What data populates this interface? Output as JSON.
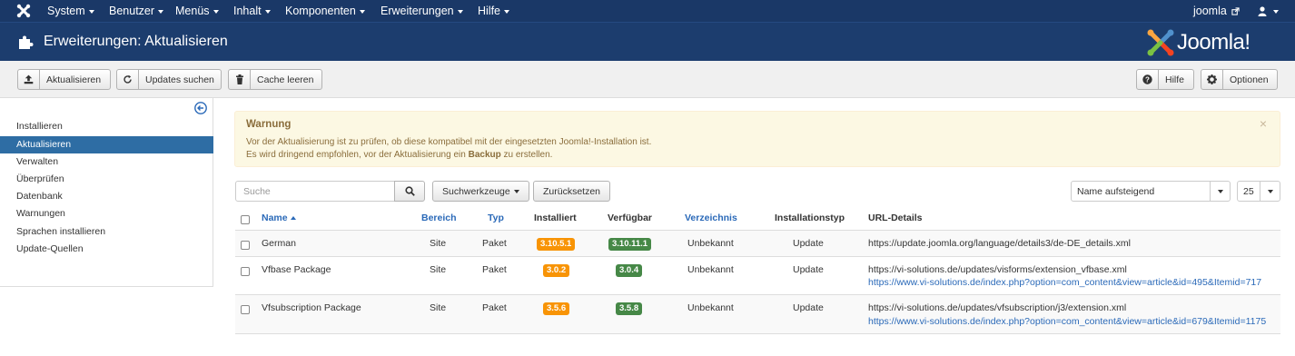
{
  "navbar": {
    "menu": [
      "System",
      "Benutzer",
      "Menüs",
      "Inhalt",
      "Komponenten",
      "Erweiterungen",
      "Hilfe"
    ],
    "site_link": "joomla",
    "user_icon": "user-icon"
  },
  "header": {
    "title": "Erweiterungen: Aktualisieren",
    "brand": "Joomla!"
  },
  "toolbar": {
    "update_label": "Aktualisieren",
    "find_label": "Updates suchen",
    "purge_label": "Cache leeren",
    "help_label": "Hilfe",
    "options_label": "Optionen"
  },
  "sidebar": {
    "items": [
      {
        "label": "Installieren"
      },
      {
        "label": "Aktualisieren"
      },
      {
        "label": "Verwalten"
      },
      {
        "label": "Überprüfen"
      },
      {
        "label": "Datenbank"
      },
      {
        "label": "Warnungen"
      },
      {
        "label": "Sprachen installieren"
      },
      {
        "label": "Update-Quellen"
      }
    ],
    "active_index": 1
  },
  "alert": {
    "heading": "Warnung",
    "line1": "Vor der Aktualisierung ist zu prüfen, ob diese kompatibel mit der eingesetzten Joomla!-Installation ist.",
    "line2_pre": "Es wird dringend empfohlen, vor der Aktualisierung ein ",
    "line2_bold": "Backup",
    "line2_post": " zu erstellen.",
    "close": "×"
  },
  "filters": {
    "search_placeholder": "Suche",
    "search_tools_label": "Suchwerkzeuge",
    "reset_label": "Zurücksetzen",
    "ordering_value": "Name aufsteigend",
    "limit_value": "25"
  },
  "table": {
    "headers": {
      "name": "Name",
      "location": "Bereich",
      "type": "Typ",
      "installed": "Installiert",
      "available": "Verfügbar",
      "folder": "Verzeichnis",
      "install_type": "Installationstyp",
      "url": "URL-Details"
    },
    "rows": [
      {
        "name": "German",
        "location": "Site",
        "type": "Paket",
        "installed": "3.10.5.1",
        "available": "3.10.11.1",
        "folder": "Unbekannt",
        "install_type": "Update",
        "url": "https://update.joomla.org/language/details3/de-DE_details.xml",
        "info_url": ""
      },
      {
        "name": "Vfbase Package",
        "location": "Site",
        "type": "Paket",
        "installed": "3.0.2",
        "available": "3.0.4",
        "folder": "Unbekannt",
        "install_type": "Update",
        "url": "https://vi-solutions.de/updates/visforms/extension_vfbase.xml",
        "info_url": "https://www.vi-solutions.de/index.php?option=com_content&view=article&id=495&Itemid=717"
      },
      {
        "name": "Vfsubscription Package",
        "location": "Site",
        "type": "Paket",
        "installed": "3.5.6",
        "available": "3.5.8",
        "folder": "Unbekannt",
        "install_type": "Update",
        "url": "https://vi-solutions.de/updates/vfsubscription/j3/extension.xml",
        "info_url": "https://www.vi-solutions.de/index.php?option=com_content&view=article&id=679&Itemid=1175"
      }
    ]
  },
  "colors": {
    "navbar": "#1a3867",
    "subhead": "#1c3d6e",
    "accent": "#2e6da4",
    "installed_badge": "#f89406",
    "available_badge": "#468847"
  }
}
